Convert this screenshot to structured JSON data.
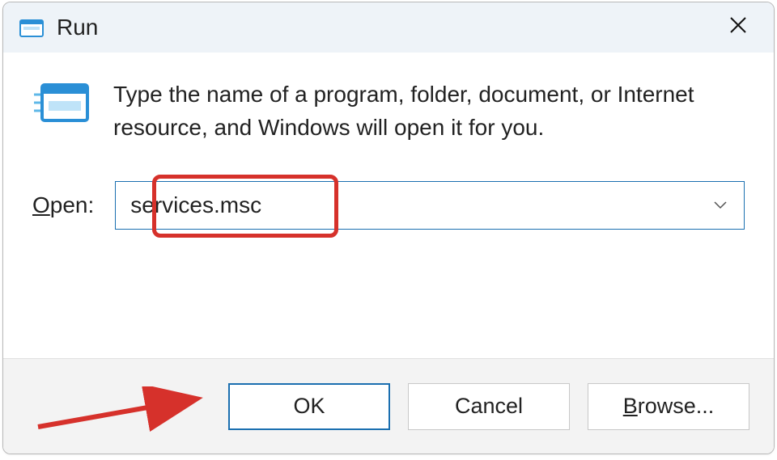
{
  "titlebar": {
    "title": "Run"
  },
  "content": {
    "description": "Type the name of a program, folder, document, or Internet resource, and Windows will open it for you.",
    "open_label_prefix": "O",
    "open_label_rest": "pen:",
    "input_value": "services.msc"
  },
  "buttons": {
    "ok": "OK",
    "cancel": "Cancel",
    "browse_prefix": "B",
    "browse_rest": "rowse..."
  },
  "annotations": {
    "highlight_color": "#d6312b",
    "arrow_color": "#d6312b"
  }
}
